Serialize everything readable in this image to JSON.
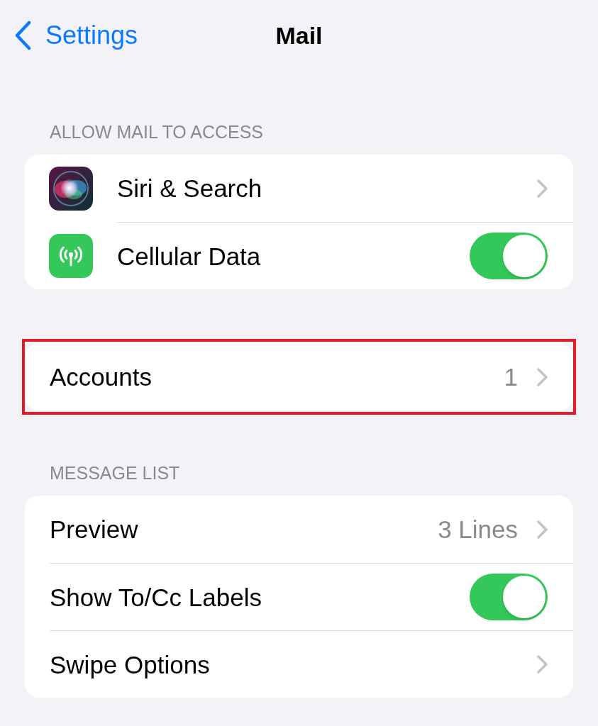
{
  "nav": {
    "back_label": "Settings",
    "title": "Mail"
  },
  "sections": [
    {
      "header": "ALLOW MAIL TO ACCESS",
      "highlighted": false,
      "rows": [
        {
          "kind": "link",
          "label": "Siri & Search"
        },
        {
          "kind": "toggle",
          "label": "Cellular Data",
          "on": true
        }
      ]
    },
    {
      "highlighted": true,
      "rows": [
        {
          "kind": "link",
          "label": "Accounts",
          "value": "1"
        }
      ]
    },
    {
      "header": "MESSAGE LIST",
      "highlighted": false,
      "rows": [
        {
          "kind": "link",
          "label": "Preview",
          "value": "3 Lines"
        },
        {
          "kind": "toggle",
          "label": "Show To/Cc Labels",
          "on": true
        },
        {
          "kind": "link",
          "label": "Swipe Options"
        }
      ]
    }
  ]
}
